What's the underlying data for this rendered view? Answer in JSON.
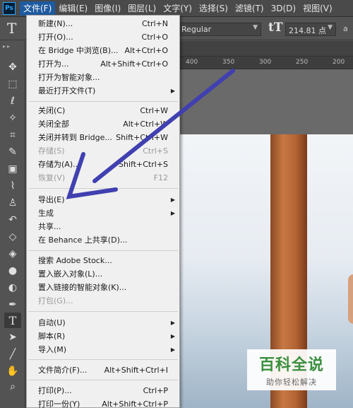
{
  "app": {
    "logo": "Ps"
  },
  "menubar": {
    "items": [
      "文件(F)",
      "编辑(E)",
      "图像(I)",
      "图层(L)",
      "文字(Y)",
      "选择(S)",
      "滤镜(T)",
      "3D(D)",
      "视图(V)"
    ],
    "active_index": 0
  },
  "options": {
    "font_style": "Regular",
    "font_size": "214.81 点",
    "aa": "a"
  },
  "ruler": {
    "numbers": [
      "400",
      "350",
      "300",
      "250",
      "200"
    ]
  },
  "file_menu": {
    "items": [
      {
        "label": "新建(N)...",
        "shortcut": "Ctrl+N"
      },
      {
        "label": "打开(O)...",
        "shortcut": "Ctrl+O"
      },
      {
        "label": "在 Bridge 中浏览(B)...",
        "shortcut": "Alt+Ctrl+O"
      },
      {
        "label": "打开为...",
        "shortcut": "Alt+Shift+Ctrl+O"
      },
      {
        "label": "打开为智能对象...",
        "shortcut": ""
      },
      {
        "label": "最近打开文件(T)",
        "shortcut": "",
        "submenu": true
      },
      {
        "label": "关闭(C)",
        "shortcut": "Ctrl+W"
      },
      {
        "label": "关闭全部",
        "shortcut": "Alt+Ctrl+W"
      },
      {
        "label": "关闭并转到 Bridge...",
        "shortcut": "Shift+Ctrl+W"
      },
      {
        "label": "存储(S)",
        "shortcut": "Ctrl+S",
        "disabled": true
      },
      {
        "label": "存储为(A)...",
        "shortcut": "Shift+Ctrl+S"
      },
      {
        "label": "恢复(V)",
        "shortcut": "F12",
        "disabled": true
      },
      {
        "label": "导出(E)",
        "shortcut": "",
        "submenu": true
      },
      {
        "label": "生成",
        "shortcut": "",
        "submenu": true
      },
      {
        "label": "共享...",
        "shortcut": ""
      },
      {
        "label": "在 Behance 上共享(D)...",
        "shortcut": ""
      },
      {
        "label": "搜索 Adobe Stock...",
        "shortcut": ""
      },
      {
        "label": "置入嵌入对象(L)...",
        "shortcut": ""
      },
      {
        "label": "置入链接的智能对象(K)...",
        "shortcut": ""
      },
      {
        "label": "打包(G)...",
        "shortcut": "",
        "disabled": true
      },
      {
        "label": "自动(U)",
        "shortcut": "",
        "submenu": true
      },
      {
        "label": "脚本(R)",
        "shortcut": "",
        "submenu": true
      },
      {
        "label": "导入(M)",
        "shortcut": "",
        "submenu": true
      },
      {
        "label": "文件简介(F)...",
        "shortcut": "Alt+Shift+Ctrl+I"
      },
      {
        "label": "打印(P)...",
        "shortcut": "Ctrl+P"
      },
      {
        "label": "打印一份(Y)",
        "shortcut": "Alt+Shift+Ctrl+P"
      }
    ]
  },
  "watermark": {
    "title": "百科全说",
    "subtitle": "助你轻松解决"
  },
  "colors": {
    "annotation_arrow": "#4040b0",
    "menu_highlight": "#1e5a9f",
    "watermark_green": "#3a8f3e"
  }
}
